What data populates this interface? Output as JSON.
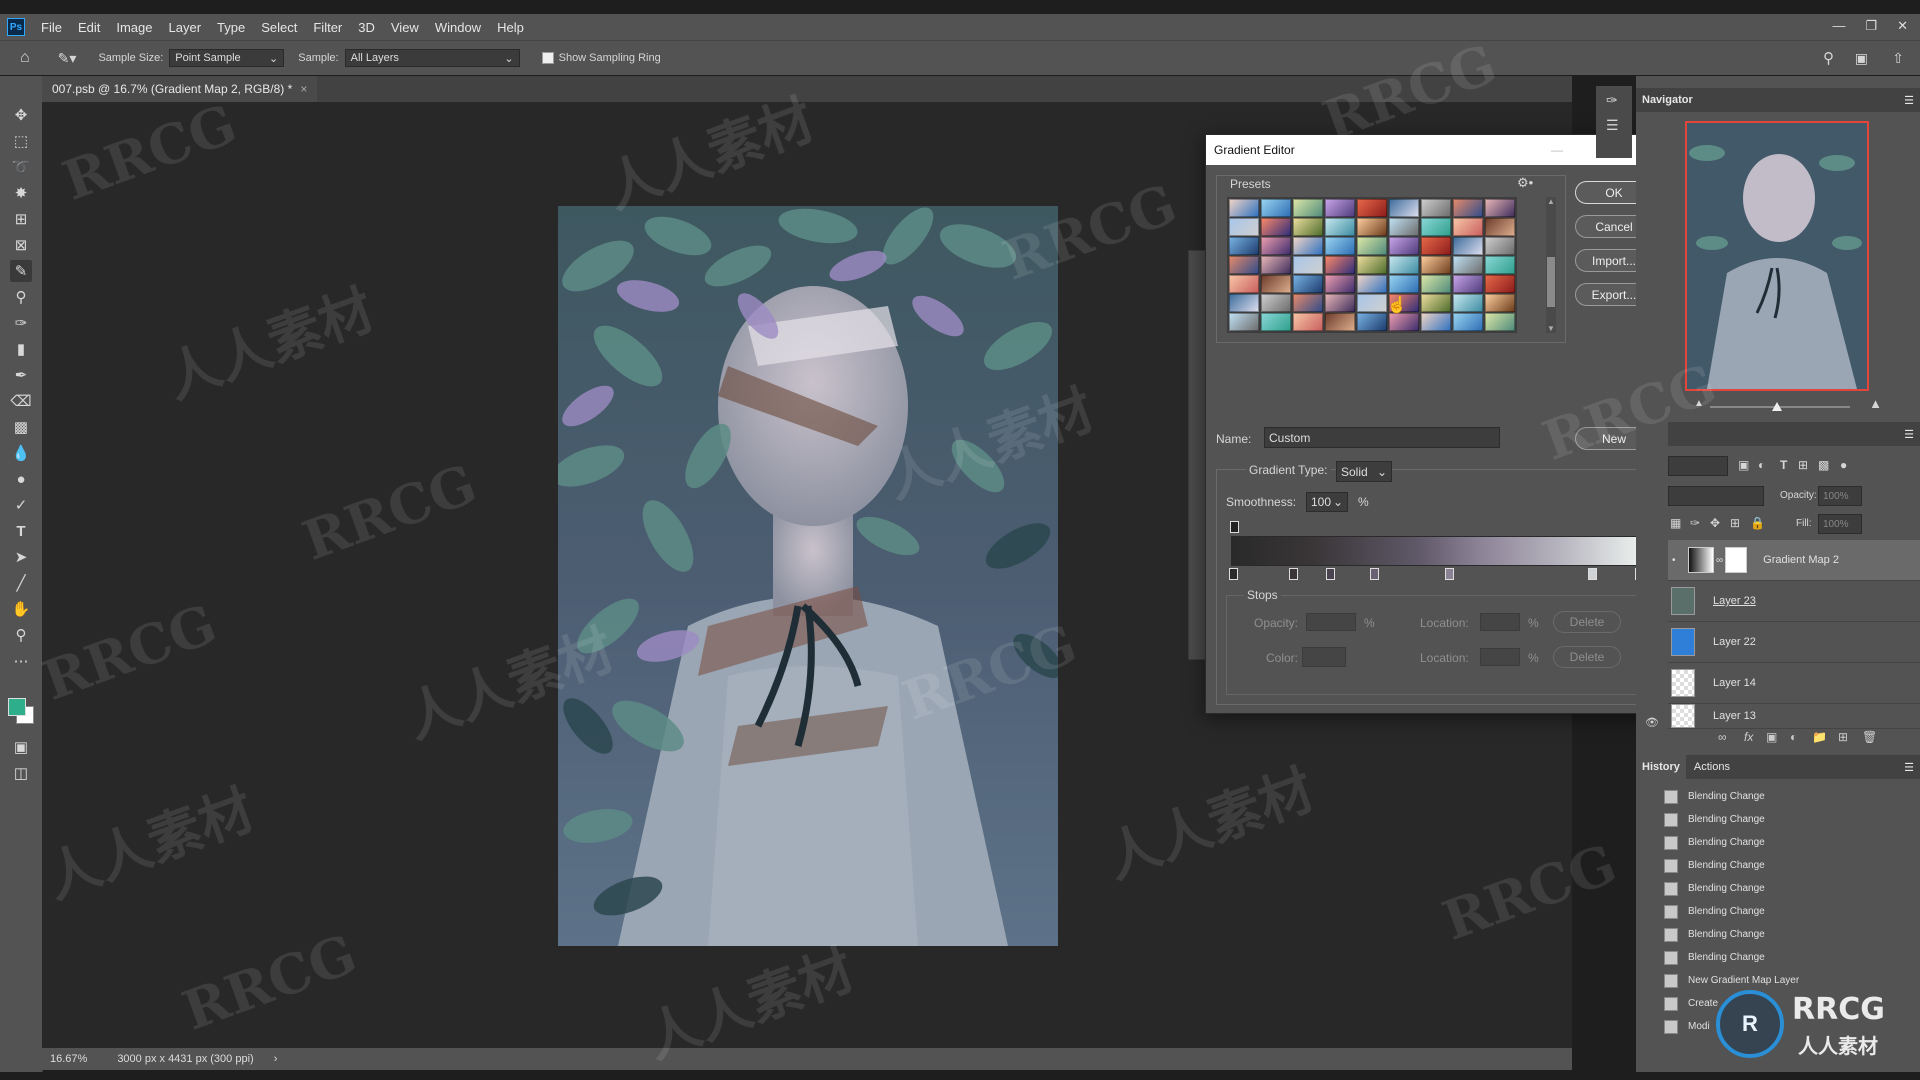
{
  "menubar": {
    "logo": "Ps",
    "items": [
      "File",
      "Edit",
      "Image",
      "Layer",
      "Type",
      "Select",
      "Filter",
      "3D",
      "View",
      "Window",
      "Help"
    ]
  },
  "options": {
    "sample_size_label": "Sample Size:",
    "sample_size_value": "Point Sample",
    "sample_label": "Sample:",
    "sample_value": "All Layers",
    "show_ring_label": "Show Sampling Ring"
  },
  "document": {
    "tab_title": "007.psb @ 16.7% (Gradient Map 2, RGB/8) *"
  },
  "status": {
    "zoom": "16.67%",
    "doc_info": "3000 px x 4431 px (300 ppi)"
  },
  "gradient_editor": {
    "title": "Gradient Editor",
    "presets_label": "Presets",
    "ok": "OK",
    "cancel": "Cancel",
    "import": "Import...",
    "export": "Export...",
    "name_label": "Name:",
    "name_value": "Custom",
    "new": "New",
    "gradient_type_label": "Gradient Type:",
    "gradient_type_value": "Solid",
    "smoothness_label": "Smoothness:",
    "smoothness_value": "100",
    "percent": "%",
    "stops_label": "Stops",
    "opacity_label": "Opacity:",
    "color_label": "Color:",
    "location_label": "Location:",
    "delete": "Delete",
    "colors": {
      "gradient_start": "#2a2a2a",
      "gradient_mid": "#8c8296",
      "gradient_end": "#eef4f0"
    }
  },
  "navigator": {
    "title": "Navigator"
  },
  "layers": {
    "opacity_label": "Opacity:",
    "opacity_value": "100%",
    "fill_label": "Fill:",
    "fill_value": "100%",
    "items": [
      {
        "name": "Gradient Map 2"
      },
      {
        "name": "Layer 23"
      },
      {
        "name": "Layer 22"
      },
      {
        "name": "Layer 14"
      },
      {
        "name": "Layer 13"
      }
    ]
  },
  "history": {
    "tab_history": "History",
    "tab_actions": "Actions",
    "items": [
      "Blending Change",
      "Blending Change",
      "Blending Change",
      "Blending Change",
      "Blending Change",
      "Blending Change",
      "Blending Change",
      "Blending Change",
      "New Gradient Map Layer",
      "Create",
      "Modi"
    ]
  },
  "watermarks": {
    "rrcg": "RRCG",
    "cn": "人人素材",
    "corner_logo": "RRCG",
    "corner_sub": "人人素材"
  },
  "accent_colors": {
    "foreground_swatch": "#2fae8c",
    "background_swatch": "#ffffff",
    "selected_layer": "#6a6a6a"
  }
}
